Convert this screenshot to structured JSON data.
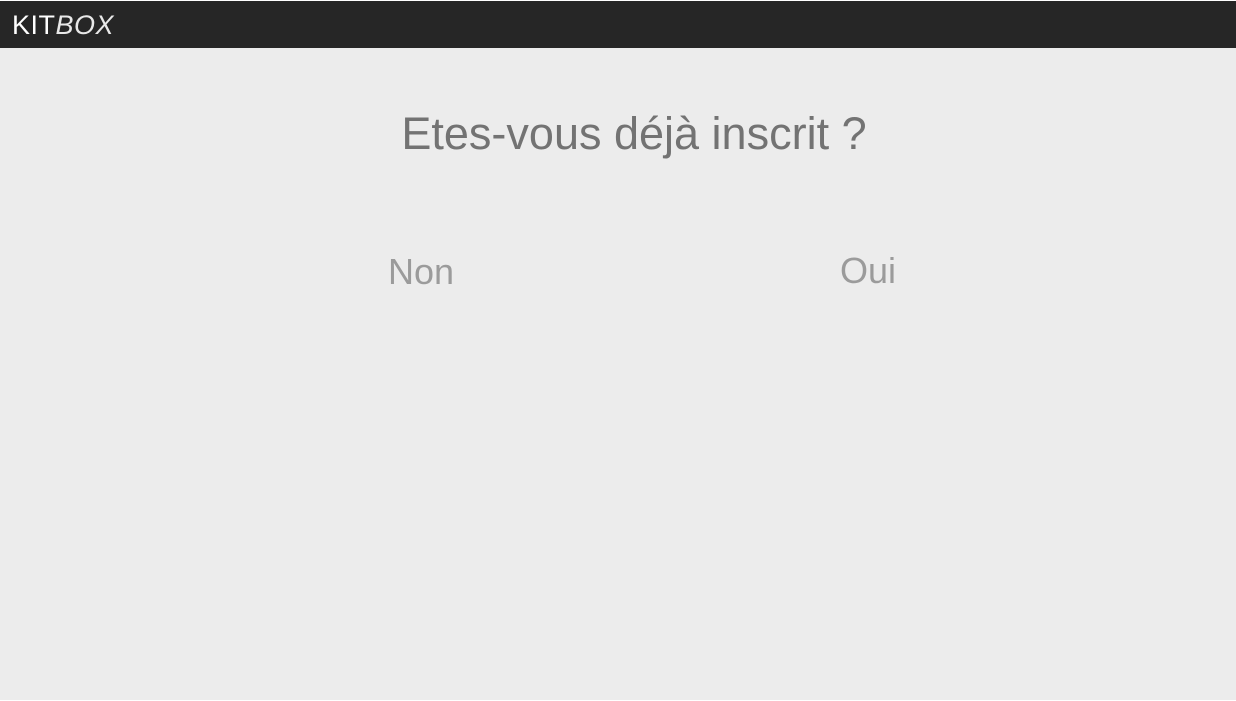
{
  "header": {
    "logo_kit": "KIT",
    "logo_box": "BOX"
  },
  "main": {
    "question": "Etes-vous déjà inscrit ?",
    "choices": [
      {
        "label": "Non"
      },
      {
        "label": "Oui"
      }
    ]
  },
  "colors": {
    "topbar_background": "#262626",
    "page_background": "#ececec",
    "question_text": "#737373",
    "choice_text": "#9b9b9b",
    "logo_text": "#ffffff"
  }
}
